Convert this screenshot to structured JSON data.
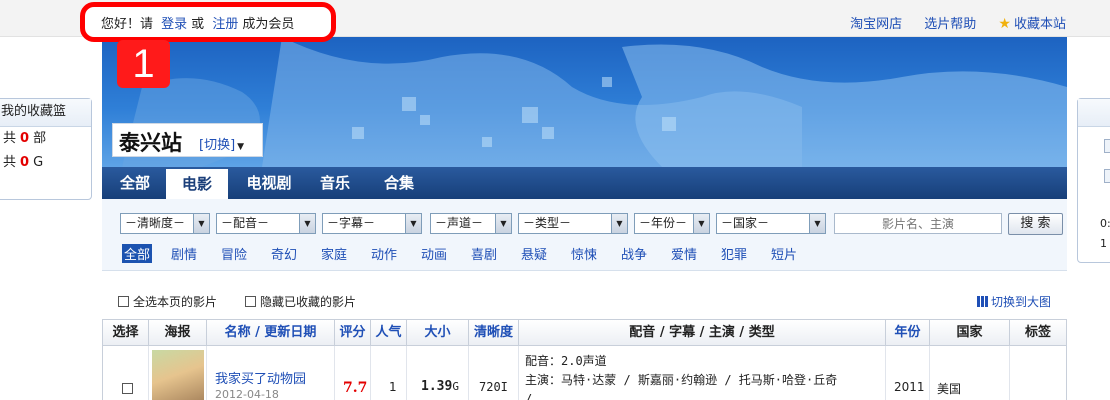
{
  "top_bar": {
    "greeting_prefix": "您好！请",
    "login_label": "登录",
    "or_label": "或",
    "register_label": "注册",
    "greeting_suffix": "成为会员",
    "marker_number": "1",
    "links": [
      "淘宝网店",
      "选片帮助",
      "收藏本站"
    ]
  },
  "left_panel": {
    "title": "我的收藏篮",
    "count_prefix": "共",
    "count_value": "0",
    "count_unit": "部",
    "size_prefix": "共",
    "size_value": "0",
    "size_unit": "G"
  },
  "right_panel": {
    "line1": "0:",
    "line2": "1"
  },
  "station": {
    "name": "泰兴站",
    "switch_label": "[切换]"
  },
  "nav": {
    "tabs": [
      "全部",
      "电影",
      "电视剧",
      "音乐",
      "合集"
    ],
    "active": "电影"
  },
  "filters": {
    "selects": [
      "－清晰度－",
      "－配音－",
      "－字幕－",
      "－声道－",
      "－类型－",
      "－年份－",
      "－国家－"
    ],
    "search_placeholder": "影片名、主演",
    "search_button": "搜 索",
    "genres": [
      "全部",
      "剧情",
      "冒险",
      "奇幻",
      "家庭",
      "动作",
      "动画",
      "喜剧",
      "悬疑",
      "惊悚",
      "战争",
      "爱情",
      "犯罪",
      "短片"
    ],
    "active_genre": "全部"
  },
  "options": {
    "select_all": "全选本页的影片",
    "hide_saved": "隐藏已收藏的影片",
    "switch_view": "切换到大图"
  },
  "table": {
    "headers": [
      "选择",
      "海报",
      "名称 / 更新日期",
      "评分",
      "人气",
      "大小",
      "清晰度",
      "配音 / 字幕 / 主演 / 类型",
      "年份",
      "国家",
      "标签"
    ],
    "rows": [
      {
        "title": "我家买了动物园",
        "date": "2012-04-18",
        "rating": "7.7",
        "popularity": "1",
        "size_value": "1.39",
        "size_unit": "G",
        "definition": "720I",
        "dub": "配音：2.0声道",
        "cast": "主演：马特·达蒙 / 斯嘉丽·约翰逊 / 托马斯·哈登·丘奇",
        "more": "/..",
        "year": "2011",
        "country": "美国",
        "tags": ""
      }
    ]
  },
  "colors": {
    "link": "#1f4fb6",
    "nav_bg": "#1b4583",
    "highlight_red": "#e30000",
    "annotation_red": "#ff0000"
  }
}
